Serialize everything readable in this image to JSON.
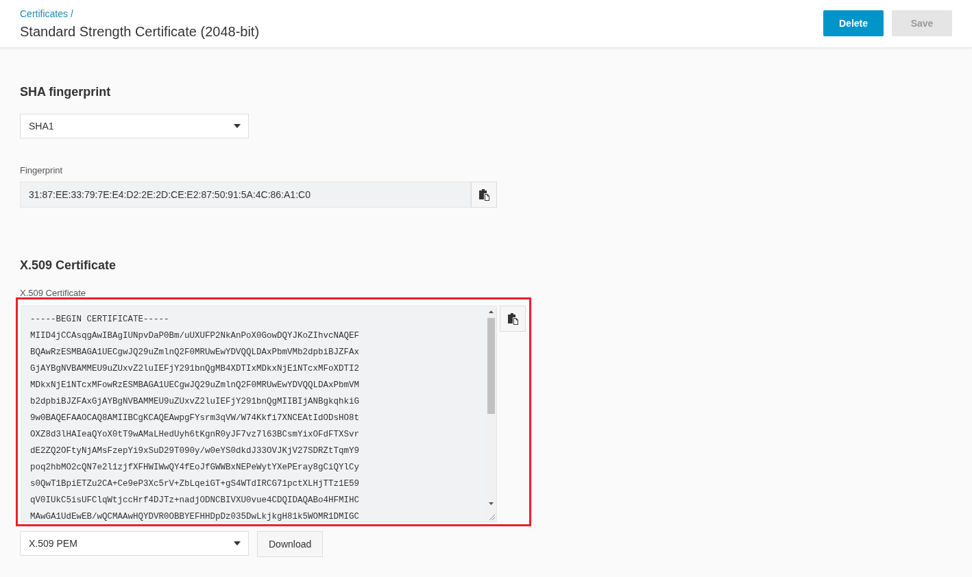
{
  "header": {
    "breadcrumb": "Certificates /",
    "title": "Standard Strength Certificate (2048-bit)",
    "buttons": [
      {
        "label": "Delete",
        "kind": "primary",
        "disabled": false
      },
      {
        "label": "Save",
        "kind": "secondary",
        "disabled": true
      }
    ]
  },
  "fingerprint_section": {
    "heading": "SHA fingerprint",
    "algorithm_select": {
      "value": "SHA1"
    },
    "fingerprint_label": "Fingerprint",
    "fingerprint_value": "31:87:EE:33:79:7E:E4:D2:2E:2D:CE:E2:87:50:91:5A:4C:86:A1:C0"
  },
  "certificate_section": {
    "heading": "X.509 Certificate",
    "field_label": "X.509 Certificate",
    "highlighted": true,
    "lines": [
      "-----BEGIN CERTIFICATE-----",
      "MIID4jCCAsqgAwIBAgIUNpvDaP0Bm/uUXUFP2NkAnPoX0GowDQYJKoZIhvcNAQEF",
      "BQAwRzESMBAGA1UECgwJQ29uZmlnQ2F0MRUwEwYDVQQLDAxPbmVMb2dpbiBJZFAx",
      "GjAYBgNVBAMMEU9uZUxvZ2luIEFjY291bnQgMB4XDTIxMDkxNjE1NTcxMFoXDTI2",
      "MDkxNjE1NTcxMFowRzESMBAGA1UECgwJQ29uZmlnQ2F0MRUwEwYDVQQLDAxPbmVM",
      "b2dpbiBJZFAxGjAYBgNVBAMMEU9uZUxvZ2luIEFjY291bnQgMIIBIjANBgkqhkiG",
      "9w0BAQEFAAOCAQ8AMIIBCgKCAQEAwpgFYsrm3qVW/W74Kkfi7XNCEAtIdODsHO8t",
      "OXZ8d3lHAIeaQYoX0tT9wAMaLHedUyh6tKgnR0yJF7vz7l63BCsmYixOFdFTXSvr",
      "dE2ZQ2OFtyNjAMsFzepYi9xSuD29T090y/w0eYS0dkdJ33OVJKjV27SDRZtTqmY9",
      "poq2hbMO2cQN7e2l1zjfXFHWIWwQY4fEoJfGWWBxNEPeWytYXePEray8gCiQYlCy",
      "s0QwT1BpiETZu2CA+Ce9eP3Xc5rV+ZbLqeiGT+gS4WTdIRCG71pctXLHjTTz1E59",
      "qV0IUkC5isUFClqWtjccHrf4DJTz+nadjODNCBIVXU0vue4CDQIDAQABo4HFMIHC",
      "MAwGA1UdEwEB/wQCMAAwHQYDVR0OBBYEFHHDpDz035DwLkjkgH81k5WOMR1DMIGC"
    ],
    "format_select": {
      "value": "X.509 PEM"
    },
    "download_button": "Download"
  }
}
